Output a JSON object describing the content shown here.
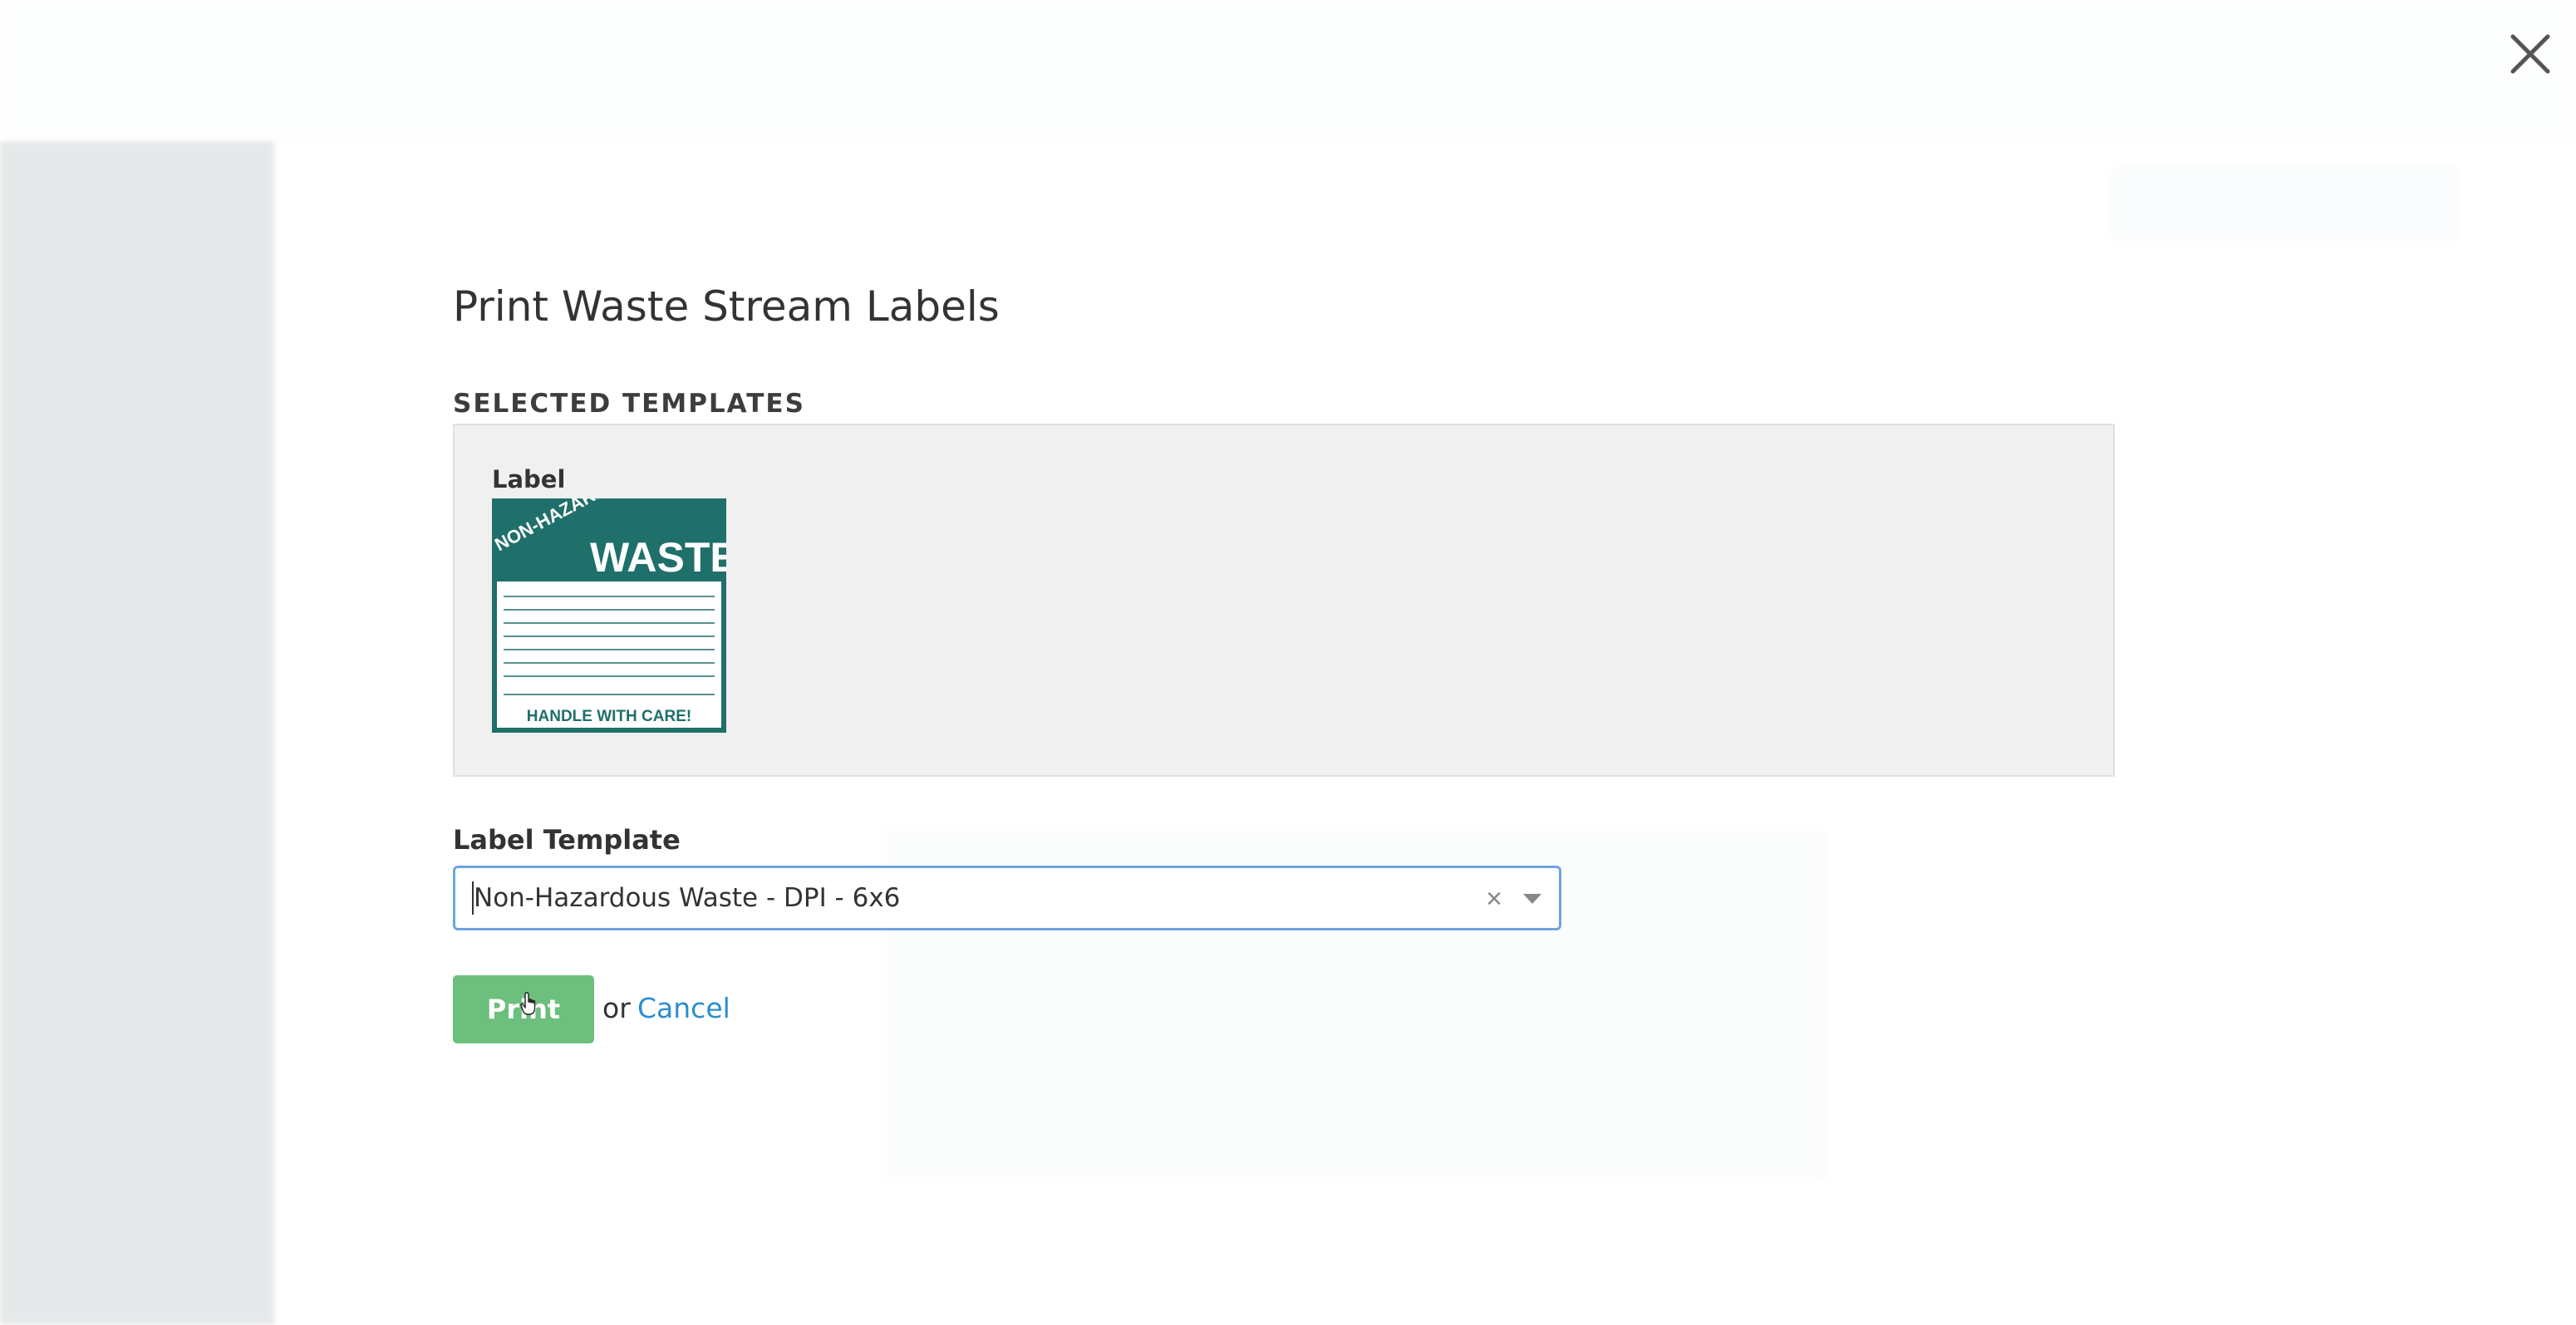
{
  "modal": {
    "title": "Print Waste Stream Labels",
    "selected_templates_heading": "SELECTED TEMPLATES",
    "template_card": {
      "label": "Label",
      "thumbnail": {
        "icon": "non-hazardous-waste-label-thumbnail",
        "banner_text": "NON-HAZARDOUS",
        "title_text": "WASTE",
        "footer_text": "HANDLE WITH CARE!",
        "accent_color": "#1f6f6a"
      }
    },
    "label_template_field": {
      "label": "Label Template",
      "value": "Non-Hazardous Waste - DPI - 6x6",
      "clear_icon": "close-icon",
      "dropdown_icon": "chevron-down-icon"
    },
    "actions": {
      "print_label": "Print",
      "or_text": "or",
      "cancel_label": "Cancel"
    },
    "close_icon": "close-icon"
  },
  "colors": {
    "primary_button": "#6cbf7c",
    "link": "#2a8ed1",
    "focus_border": "#6fa3e0"
  }
}
